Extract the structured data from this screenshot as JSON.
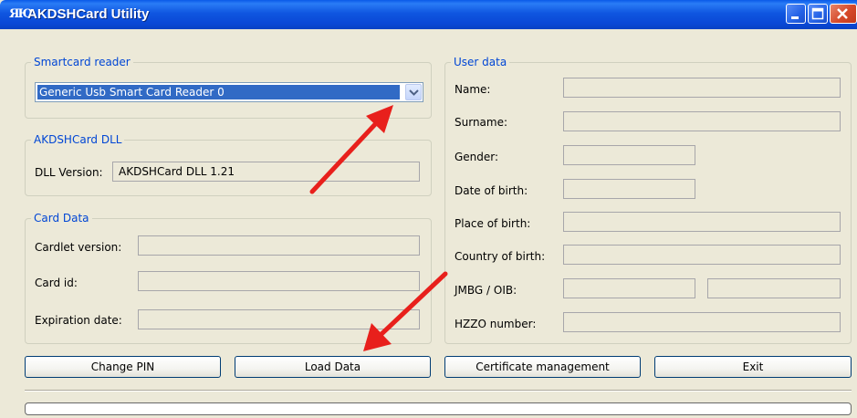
{
  "window": {
    "title": "AKDSHCard Utility",
    "icon_text": "ЯЮ"
  },
  "smartcard_reader": {
    "title": "Smartcard reader",
    "selected": "Generic Usb Smart Card Reader 0"
  },
  "dll": {
    "title": "AKDSHCard DLL",
    "version_label": "DLL Version:",
    "version_value": "AKDSHCard DLL 1.21"
  },
  "card_data": {
    "title": "Card Data",
    "cardlet_version_label": "Cardlet version:",
    "card_id_label": "Card id:",
    "expiration_date_label": "Expiration date:"
  },
  "user_data": {
    "title": "User data",
    "name_label": "Name:",
    "surname_label": "Surname:",
    "gender_label": "Gender:",
    "date_of_birth_label": "Date of birth:",
    "place_of_birth_label": "Place of birth:",
    "country_of_birth_label": "Country of birth:",
    "jmbg_oib_label": "JMBG / OIB:",
    "hzzo_label": "HZZO number:"
  },
  "buttons": {
    "change_pin": "Change PIN",
    "load_data": "Load Data",
    "certificate_management": "Certificate management",
    "exit": "Exit"
  },
  "colors": {
    "title_bar": "#0a5ae8",
    "window_bg": "#ece9d8",
    "group_title": "#0046d5",
    "selection": "#316ac5",
    "annotation_arrow": "#e8201c"
  },
  "progress": {
    "value": 0
  }
}
